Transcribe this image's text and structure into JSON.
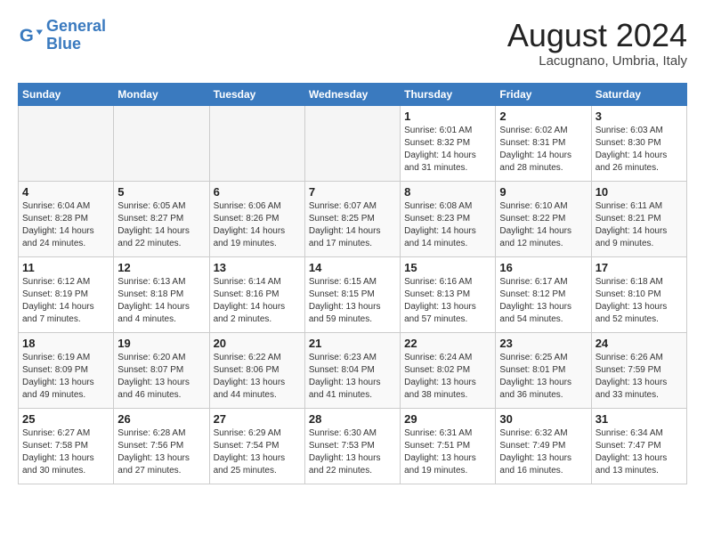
{
  "header": {
    "logo_line1": "General",
    "logo_line2": "Blue",
    "month_title": "August 2024",
    "location": "Lacugnano, Umbria, Italy"
  },
  "calendar": {
    "days_of_week": [
      "Sunday",
      "Monday",
      "Tuesday",
      "Wednesday",
      "Thursday",
      "Friday",
      "Saturday"
    ],
    "weeks": [
      [
        {
          "day": "",
          "empty": true
        },
        {
          "day": "",
          "empty": true
        },
        {
          "day": "",
          "empty": true
        },
        {
          "day": "",
          "empty": true
        },
        {
          "day": "1",
          "sunrise": "6:01 AM",
          "sunset": "8:32 PM",
          "daylight": "14 hours and 31 minutes."
        },
        {
          "day": "2",
          "sunrise": "6:02 AM",
          "sunset": "8:31 PM",
          "daylight": "14 hours and 28 minutes."
        },
        {
          "day": "3",
          "sunrise": "6:03 AM",
          "sunset": "8:30 PM",
          "daylight": "14 hours and 26 minutes."
        }
      ],
      [
        {
          "day": "4",
          "sunrise": "6:04 AM",
          "sunset": "8:28 PM",
          "daylight": "14 hours and 24 minutes."
        },
        {
          "day": "5",
          "sunrise": "6:05 AM",
          "sunset": "8:27 PM",
          "daylight": "14 hours and 22 minutes."
        },
        {
          "day": "6",
          "sunrise": "6:06 AM",
          "sunset": "8:26 PM",
          "daylight": "14 hours and 19 minutes."
        },
        {
          "day": "7",
          "sunrise": "6:07 AM",
          "sunset": "8:25 PM",
          "daylight": "14 hours and 17 minutes."
        },
        {
          "day": "8",
          "sunrise": "6:08 AM",
          "sunset": "8:23 PM",
          "daylight": "14 hours and 14 minutes."
        },
        {
          "day": "9",
          "sunrise": "6:10 AM",
          "sunset": "8:22 PM",
          "daylight": "14 hours and 12 minutes."
        },
        {
          "day": "10",
          "sunrise": "6:11 AM",
          "sunset": "8:21 PM",
          "daylight": "14 hours and 9 minutes."
        }
      ],
      [
        {
          "day": "11",
          "sunrise": "6:12 AM",
          "sunset": "8:19 PM",
          "daylight": "14 hours and 7 minutes."
        },
        {
          "day": "12",
          "sunrise": "6:13 AM",
          "sunset": "8:18 PM",
          "daylight": "14 hours and 4 minutes."
        },
        {
          "day": "13",
          "sunrise": "6:14 AM",
          "sunset": "8:16 PM",
          "daylight": "14 hours and 2 minutes."
        },
        {
          "day": "14",
          "sunrise": "6:15 AM",
          "sunset": "8:15 PM",
          "daylight": "13 hours and 59 minutes."
        },
        {
          "day": "15",
          "sunrise": "6:16 AM",
          "sunset": "8:13 PM",
          "daylight": "13 hours and 57 minutes."
        },
        {
          "day": "16",
          "sunrise": "6:17 AM",
          "sunset": "8:12 PM",
          "daylight": "13 hours and 54 minutes."
        },
        {
          "day": "17",
          "sunrise": "6:18 AM",
          "sunset": "8:10 PM",
          "daylight": "13 hours and 52 minutes."
        }
      ],
      [
        {
          "day": "18",
          "sunrise": "6:19 AM",
          "sunset": "8:09 PM",
          "daylight": "13 hours and 49 minutes."
        },
        {
          "day": "19",
          "sunrise": "6:20 AM",
          "sunset": "8:07 PM",
          "daylight": "13 hours and 46 minutes."
        },
        {
          "day": "20",
          "sunrise": "6:22 AM",
          "sunset": "8:06 PM",
          "daylight": "13 hours and 44 minutes."
        },
        {
          "day": "21",
          "sunrise": "6:23 AM",
          "sunset": "8:04 PM",
          "daylight": "13 hours and 41 minutes."
        },
        {
          "day": "22",
          "sunrise": "6:24 AM",
          "sunset": "8:02 PM",
          "daylight": "13 hours and 38 minutes."
        },
        {
          "day": "23",
          "sunrise": "6:25 AM",
          "sunset": "8:01 PM",
          "daylight": "13 hours and 36 minutes."
        },
        {
          "day": "24",
          "sunrise": "6:26 AM",
          "sunset": "7:59 PM",
          "daylight": "13 hours and 33 minutes."
        }
      ],
      [
        {
          "day": "25",
          "sunrise": "6:27 AM",
          "sunset": "7:58 PM",
          "daylight": "13 hours and 30 minutes."
        },
        {
          "day": "26",
          "sunrise": "6:28 AM",
          "sunset": "7:56 PM",
          "daylight": "13 hours and 27 minutes."
        },
        {
          "day": "27",
          "sunrise": "6:29 AM",
          "sunset": "7:54 PM",
          "daylight": "13 hours and 25 minutes."
        },
        {
          "day": "28",
          "sunrise": "6:30 AM",
          "sunset": "7:53 PM",
          "daylight": "13 hours and 22 minutes."
        },
        {
          "day": "29",
          "sunrise": "6:31 AM",
          "sunset": "7:51 PM",
          "daylight": "13 hours and 19 minutes."
        },
        {
          "day": "30",
          "sunrise": "6:32 AM",
          "sunset": "7:49 PM",
          "daylight": "13 hours and 16 minutes."
        },
        {
          "day": "31",
          "sunrise": "6:34 AM",
          "sunset": "7:47 PM",
          "daylight": "13 hours and 13 minutes."
        }
      ]
    ]
  }
}
